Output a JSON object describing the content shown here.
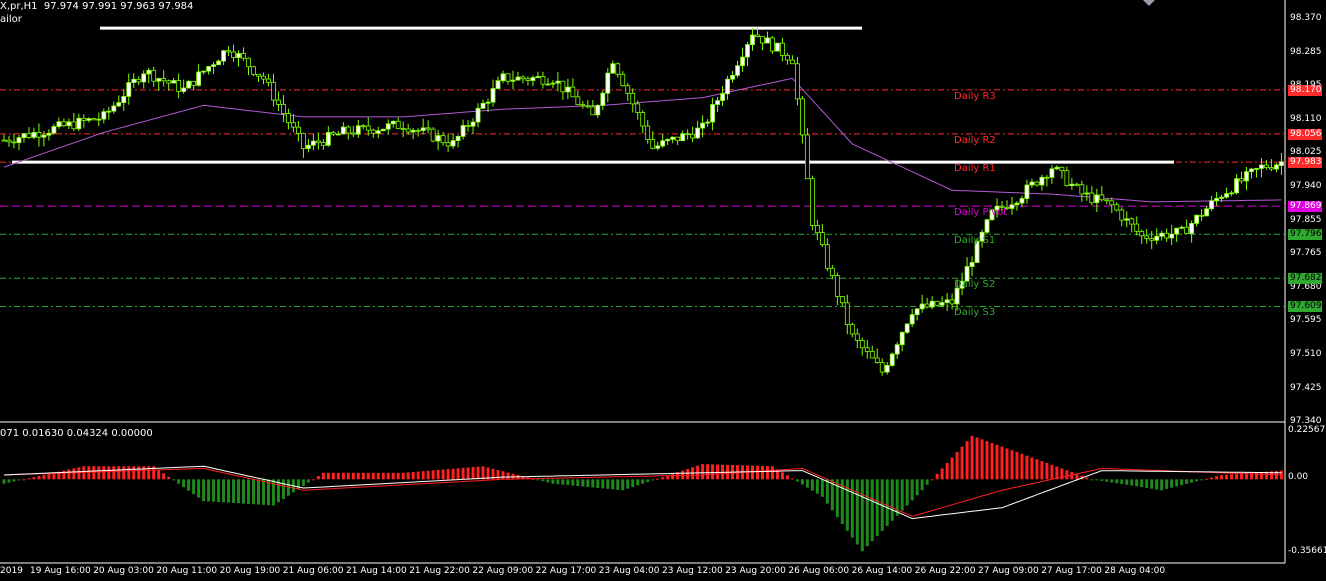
{
  "header": {
    "symbol_line": "X,pr,H1  97.974 97.991 97.963 97.984",
    "indicator_name": "ailor",
    "indicator_values": "071 0.01630 0.04324 0.00000"
  },
  "colors": {
    "background": "#000000",
    "bull_candle": "#ffffff",
    "bear_candle": "#000000",
    "wick": "#7fff00",
    "ma_line": "#b05ad6",
    "resistance": "#ff2a2a",
    "support": "#2ea82e",
    "pivot": "#e000e0",
    "hist_positive": "#ff2020",
    "hist_negative": "#1e8a1e"
  },
  "price_axis": {
    "ticks": [
      "98.370",
      "98.285",
      "98.195",
      "98.110",
      "98.025",
      "97.940",
      "97.855",
      "97.765",
      "97.680",
      "97.595",
      "97.510",
      "97.425",
      "97.340"
    ]
  },
  "indicator_axis": {
    "ticks": [
      "0.22567",
      "0.00",
      "-0.35661"
    ]
  },
  "time_axis": {
    "ticks": [
      "2019",
      "19 Aug 16:00",
      "20 Aug 03:00",
      "20 Aug 11:00",
      "20 Aug 19:00",
      "21 Aug 06:00",
      "21 Aug 14:00",
      "21 Aug 22:00",
      "22 Aug 09:00",
      "22 Aug 17:00",
      "23 Aug 04:00",
      "23 Aug 12:00",
      "23 Aug 20:00",
      "26 Aug 06:00",
      "26 Aug 14:00",
      "26 Aug 22:00",
      "27 Aug 09:00",
      "27 Aug 17:00",
      "28 Aug 04:00"
    ]
  },
  "levels": [
    {
      "name": "Daily R3",
      "price": 98.17,
      "badge": "98.170",
      "kind": "resistance"
    },
    {
      "name": "Daily R2",
      "price": 98.056,
      "badge": "98.056",
      "kind": "resistance"
    },
    {
      "name": "Daily R1",
      "price": 97.983,
      "badge": "97.983",
      "kind": "resistance"
    },
    {
      "name": "Daily Pivot",
      "price": 97.869,
      "badge": "97.869",
      "kind": "pivot"
    },
    {
      "name": "Daily S1",
      "price": 97.796,
      "badge": "97.796",
      "kind": "support"
    },
    {
      "name": "Daily S2",
      "price": 97.682,
      "badge": "97.682",
      "kind": "support"
    },
    {
      "name": "Daily S3",
      "price": 97.609,
      "badge": "97.609",
      "kind": "support"
    }
  ],
  "chart_data": {
    "type": "candlestick",
    "timeframe": "H1",
    "y_range": [
      97.32,
      98.39
    ],
    "last_ohlc": {
      "open": 97.974,
      "high": 97.991,
      "low": 97.963,
      "close": 97.984
    },
    "horizontal_lines": [
      98.33,
      97.983
    ],
    "close_path_anchors": [
      [
        0,
        98.04
      ],
      [
        10,
        98.07
      ],
      [
        20,
        98.1
      ],
      [
        28,
        98.22
      ],
      [
        36,
        98.17
      ],
      [
        45,
        98.28
      ],
      [
        52,
        98.2
      ],
      [
        60,
        98.02
      ],
      [
        68,
        98.06
      ],
      [
        80,
        98.08
      ],
      [
        90,
        98.03
      ],
      [
        100,
        98.2
      ],
      [
        110,
        98.2
      ],
      [
        118,
        98.1
      ],
      [
        122,
        98.25
      ],
      [
        130,
        98.02
      ],
      [
        140,
        98.07
      ],
      [
        150,
        98.32
      ],
      [
        158,
        98.25
      ],
      [
        162,
        97.83
      ],
      [
        170,
        97.53
      ],
      [
        176,
        97.44
      ],
      [
        182,
        97.6
      ],
      [
        190,
        97.62
      ],
      [
        198,
        97.85
      ],
      [
        204,
        97.9
      ],
      [
        210,
        97.97
      ],
      [
        216,
        97.9
      ],
      [
        222,
        97.87
      ],
      [
        228,
        97.79
      ],
      [
        236,
        97.8
      ],
      [
        244,
        97.9
      ],
      [
        252,
        97.97
      ],
      [
        256,
        97.984
      ]
    ],
    "moving_average_anchors": [
      [
        0,
        97.97
      ],
      [
        20,
        98.06
      ],
      [
        40,
        98.13
      ],
      [
        60,
        98.1
      ],
      [
        80,
        98.1
      ],
      [
        100,
        98.12
      ],
      [
        120,
        98.13
      ],
      [
        140,
        98.15
      ],
      [
        158,
        98.2
      ],
      [
        170,
        98.03
      ],
      [
        190,
        97.91
      ],
      [
        210,
        97.9
      ],
      [
        230,
        97.88
      ],
      [
        256,
        97.885
      ]
    ],
    "histogram_anchors": [
      [
        0,
        -0.02
      ],
      [
        16,
        0.06
      ],
      [
        30,
        0.06
      ],
      [
        40,
        -0.1
      ],
      [
        54,
        -0.12
      ],
      [
        64,
        0.03
      ],
      [
        80,
        0.03
      ],
      [
        96,
        0.06
      ],
      [
        110,
        -0.02
      ],
      [
        124,
        -0.05
      ],
      [
        140,
        0.07
      ],
      [
        154,
        0.06
      ],
      [
        164,
        -0.08
      ],
      [
        172,
        -0.33
      ],
      [
        184,
        -0.05
      ],
      [
        194,
        0.2
      ],
      [
        206,
        0.1
      ],
      [
        218,
        0.0
      ],
      [
        232,
        -0.05
      ],
      [
        244,
        0.02
      ],
      [
        256,
        0.04
      ]
    ],
    "signal_line_anchors": [
      [
        0,
        0.02
      ],
      [
        40,
        0.05
      ],
      [
        60,
        -0.05
      ],
      [
        100,
        0.0
      ],
      [
        140,
        0.02
      ],
      [
        160,
        0.05
      ],
      [
        182,
        -0.17
      ],
      [
        200,
        -0.05
      ],
      [
        220,
        0.05
      ],
      [
        256,
        0.02
      ]
    ],
    "main_line_anchors": [
      [
        0,
        0.02
      ],
      [
        40,
        0.06
      ],
      [
        60,
        -0.04
      ],
      [
        100,
        0.01
      ],
      [
        140,
        0.03
      ],
      [
        160,
        0.04
      ],
      [
        182,
        -0.18
      ],
      [
        200,
        -0.13
      ],
      [
        220,
        0.04
      ],
      [
        256,
        0.03
      ]
    ]
  }
}
